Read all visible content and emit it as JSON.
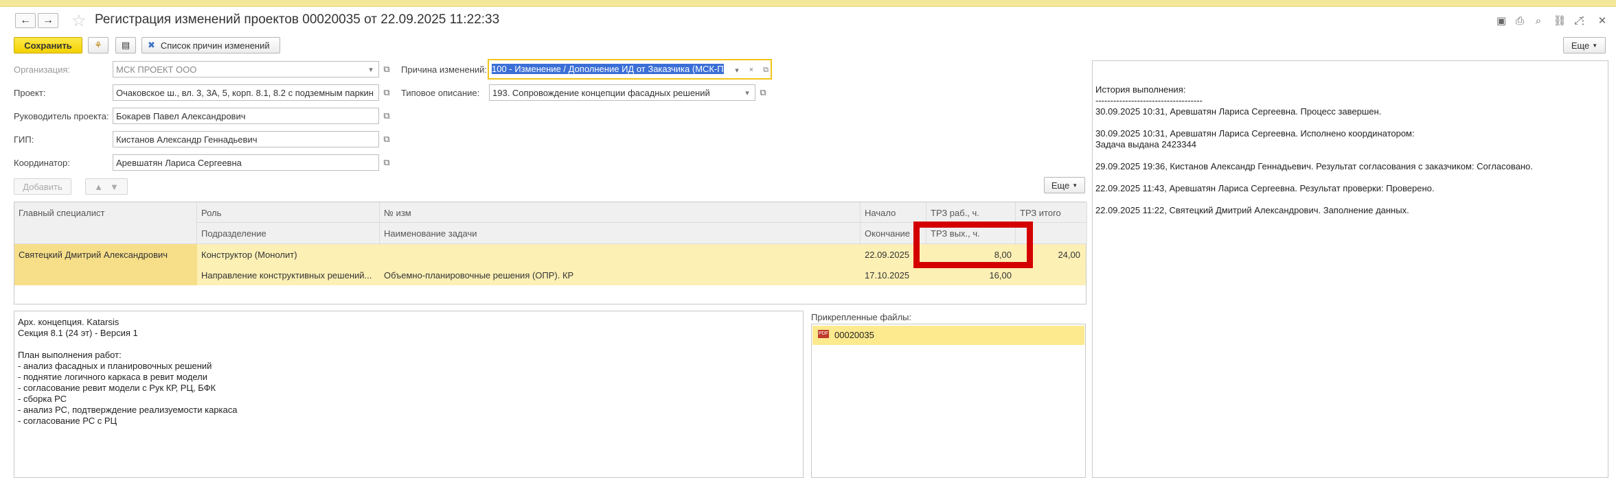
{
  "window": {
    "title": "Регистрация изменений проектов 00020035 от 22.09.2025 11:22:33"
  },
  "toolbar": {
    "save_label": "Сохранить",
    "reasons_list_label": "Список причин изменений",
    "more_label": "Еще"
  },
  "form": {
    "organization_label": "Организация:",
    "organization_value": "МСК ПРОЕКТ ООО",
    "project_label": "Проект:",
    "project_value": "Очаковское ш., вл. 3, 3А, 5, корп. 8.1, 8.2 с подземным паркин",
    "manager_label": "Руководитель проекта:",
    "manager_value": "Бокарев Павел Александрович",
    "gip_label": "ГИП:",
    "gip_value": "Кистанов Александр Геннадьевич",
    "coordinator_label": "Координатор:",
    "coordinator_value": "Аревшатян Лариса Сергеевна",
    "reason_label": "Причина изменений:",
    "reason_value": "100 - Изменение / Дополнение ИД от Заказчика (МСК-П",
    "typical_label": "Типовое описание:",
    "typical_value": "193. Сопровождение концепции фасадных решений"
  },
  "table_toolbar": {
    "add_label": "Добавить",
    "more_label": "Еще"
  },
  "table": {
    "headers_row1": [
      "Главный специалист",
      "Роль",
      "№ изм",
      "Начало",
      "ТРЗ раб., ч.",
      "ТРЗ итого"
    ],
    "headers_row2": [
      "Подразделение",
      "Наименование задачи",
      "Окончание",
      "ТРЗ вых., ч."
    ],
    "row": {
      "specialist": "Святецкий Дмитрий Александрович",
      "role": "Конструктор (Монолит)",
      "change_no": "",
      "start": "22.09.2025",
      "trz_work": "8,00",
      "trz_total": "24,00",
      "department": "Направление конструктивных решений...",
      "task_name": "Объемно-планировочные решения (ОПР). КР",
      "end": "17.10.2025",
      "trz_off": "16,00"
    }
  },
  "description": {
    "lines": [
      "Арх. концепция. Katarsis",
      "Секция 8.1 (24 эт) - Версия 1",
      "",
      "План выполнения работ:",
      "- анализ фасадных и планировочных решений",
      "- поднятие логичного каркаса в ревит модели",
      "- согласование ревит модели с Рук КР, РЦ, БФК",
      "- сборка РС",
      "- анализ РС, подтверждение реализуемости каркаса",
      "- согласование РС с РЦ"
    ]
  },
  "files": {
    "label": "Прикрепленные файлы:",
    "items": [
      "00020035"
    ]
  },
  "history": {
    "lines": [
      "История выполнения:",
      "------------------------------------",
      "30.09.2025 10:31, Аревшатян Лариса Сергеевна. Процесс завершен.",
      "",
      "30.09.2025 10:31, Аревшатян Лариса Сергеевна. Исполнено координатором:",
      "Задача выдана 2423344",
      "",
      "29.09.2025 19:36, Кистанов Александр Геннадьевич. Результат согласования с заказчиком: Согласовано.",
      "",
      "22.09.2025 11:43, Аревшатян Лариса Сергеевна. Результат проверки: Проверено.",
      "",
      "22.09.2025 11:22, Святецкий Дмитрий Александрович. Заполнение данных."
    ]
  },
  "colors": {
    "accent": "#f3d100",
    "selected_row": "#fdf0b5",
    "highlight_box": "#d40000"
  }
}
